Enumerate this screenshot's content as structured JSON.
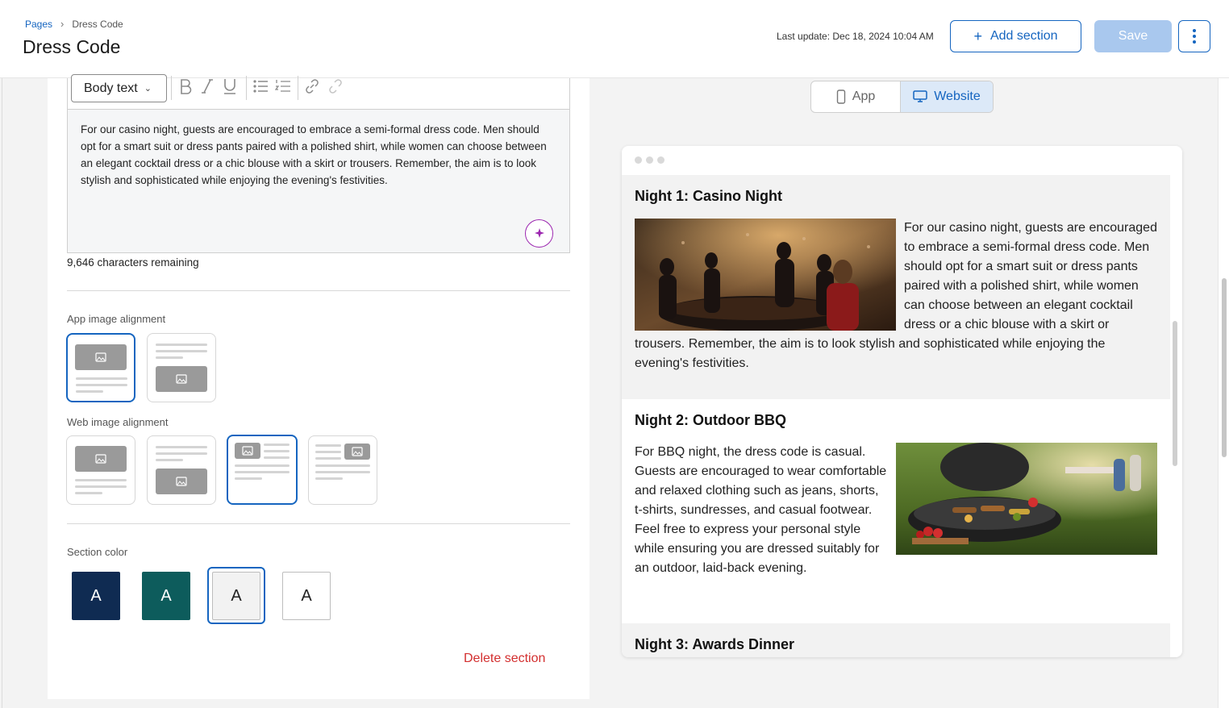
{
  "breadcrumb": {
    "root": "Pages",
    "current": "Dress Code"
  },
  "page_title": "Dress Code",
  "header": {
    "last_update": "Last update: Dec 18, 2024 10:04 AM",
    "add_section_label": "Add section",
    "save_label": "Save"
  },
  "editor": {
    "style_select": "Body text",
    "toolbar_icons": [
      "bold-icon",
      "italic-icon",
      "underline-icon",
      "bullet-list-icon",
      "numbered-list-icon",
      "link-icon",
      "unlink-icon"
    ],
    "body": "For our casino night, guests are encouraged to embrace a semi-formal dress code. Men should opt for a smart suit or dress pants paired with a polished shirt, while women can choose between an elegant cocktail dress or a chic blouse with a skirt or trousers. Remember, the aim is to look stylish and sophisticated while enjoying the evening's festivities.",
    "chars_remaining": "9,646 characters remaining"
  },
  "app_image_alignment": {
    "label": "App image alignment",
    "selected_index": 0
  },
  "web_image_alignment": {
    "label": "Web image alignment",
    "selected_index": 2
  },
  "section_color": {
    "label": "Section color",
    "swatch_letter": "A",
    "swatches": [
      "#0f2b52",
      "#0d5c5c",
      "#f2f2f2",
      "#ffffff"
    ],
    "selected_index": 2
  },
  "delete_label": "Delete section",
  "device_toggle": {
    "app": "App",
    "website": "Website",
    "selected": "website"
  },
  "preview": {
    "sections": [
      {
        "title": "Night 1: Casino Night",
        "body": "For our casino night, guests are encouraged to embrace a semi-formal dress code. Men should opt for a smart suit or dress pants paired with a polished shirt, while women can choose between an elegant cocktail dress or a chic blouse with a skirt or trousers. Remember, the aim is to look stylish and sophisticated while enjoying the evening's festivities.",
        "image": "casino-photo"
      },
      {
        "title": "Night 2: Outdoor BBQ",
        "body": "For BBQ night, the dress code is casual. Guests are encouraged to wear comfortable and relaxed clothing such as jeans, shorts, t-shirts, sundresses, and casual footwear. Feel free to express your personal style while ensuring you are dressed suitably for an outdoor, laid-back evening.",
        "image": "bbq-photo"
      },
      {
        "title": "Night 3: Awards Dinner"
      }
    ]
  },
  "colors": {
    "accent": "#1565c0",
    "danger": "#d32f2f",
    "ai": "#9c27b0",
    "save_disabled": "#a9c8ee"
  }
}
